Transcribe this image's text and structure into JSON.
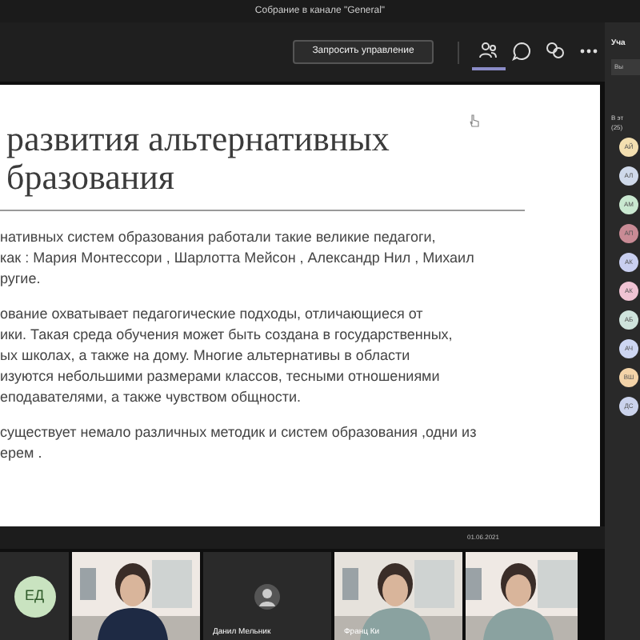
{
  "window": {
    "title": "Собрание в канале \"General\""
  },
  "toolbar": {
    "request_button": "Запросить управление",
    "tabs": [
      {
        "kind": "people",
        "selected": true
      },
      {
        "kind": "chat",
        "selected": false
      },
      {
        "kind": "rooms",
        "selected": false
      },
      {
        "kind": "more",
        "selected": false
      }
    ]
  },
  "slide": {
    "title_lines": [
      "развития альтернативных",
      "бразования"
    ],
    "paragraphs": [
      [
        "нативных систем образования работали такие великие педагоги,",
        "как : Мария Монтессори , Шарлотта Мейсон , Александр Нил , Михаил",
        "ругие."
      ],
      [
        "ование охватывает педагогические подходы, отличающиеся от",
        "ики. Такая среда обучения может быть создана в государственных,",
        "ых школах, а также на дому. Многие альтернативы в области",
        "изуются небольшими размерами классов, тесными отношениями",
        "еподавателями, а также чувством общности."
      ],
      [
        "существует немало различных методик и систем образования ,одни из",
        "ерем ."
      ]
    ],
    "date": "01.06.2021"
  },
  "videos": [
    {
      "kind": "avatar",
      "initials": "ЕД",
      "color": "#c9e3c0"
    },
    {
      "kind": "picture"
    },
    {
      "kind": "avatar",
      "name": "Данил Мельник"
    },
    {
      "kind": "picture",
      "name": "Франц Ки"
    },
    {
      "kind": "picture"
    }
  ],
  "participants": {
    "title": "Уча",
    "button": "Вы",
    "group": "В эт",
    "count": "(25)",
    "people": [
      {
        "initials": "АЙ",
        "color": "#f3dfb0"
      },
      {
        "initials": "АЛ",
        "color": "#cfd9ea"
      },
      {
        "initials": "АМ",
        "color": "#c9e8d0"
      },
      {
        "initials": "АП",
        "color": "#c98b95"
      },
      {
        "initials": "АК",
        "color": "#c9cff0"
      },
      {
        "initials": "АК",
        "color": "#f0c3d3"
      },
      {
        "initials": "АБ",
        "color": "#cfe3dc"
      },
      {
        "initials": "АЧ",
        "color": "#cdd6f2"
      },
      {
        "initials": "ВШ",
        "color": "#f3d3a8"
      },
      {
        "initials": "ДС",
        "color": "#cbd3ec"
      }
    ]
  }
}
